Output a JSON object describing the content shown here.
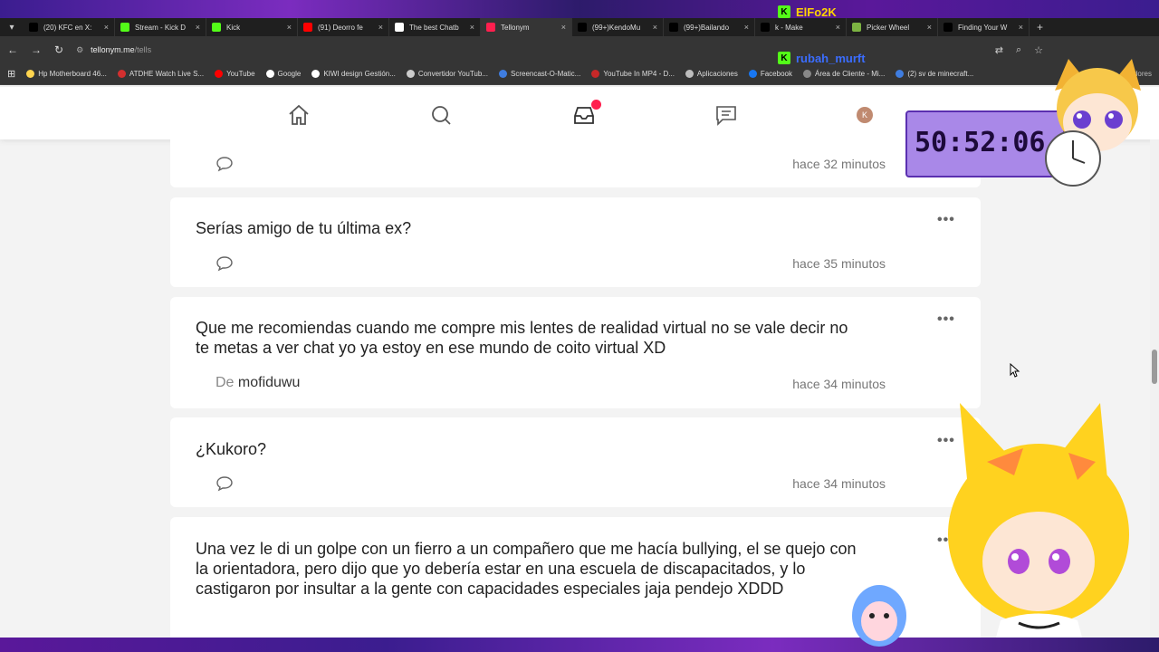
{
  "browser": {
    "tabs": [
      {
        "label": "(20) KFC en X:",
        "icon": "x-icon",
        "color": "#000000"
      },
      {
        "label": "Stream - Kick D",
        "icon": "kick-icon",
        "color": "#53fc18"
      },
      {
        "label": "Kick",
        "icon": "kick-icon",
        "color": "#53fc18"
      },
      {
        "label": "(91) Deorro fe",
        "icon": "youtube-icon",
        "color": "#ff0000"
      },
      {
        "label": "The best Chatb",
        "icon": "diamond-icon",
        "color": "#ffffff"
      },
      {
        "label": "Tellonym",
        "icon": "tellonym-icon",
        "color": "#ff1f4e"
      },
      {
        "label": "(99+)KendoMu",
        "icon": "tiktok-icon",
        "color": "#000000"
      },
      {
        "label": "(99+)Bailando",
        "icon": "tiktok-icon",
        "color": "#000000"
      },
      {
        "label": "k - Make",
        "icon": "tiktok-icon",
        "color": "#000000"
      },
      {
        "label": "Picker Wheel",
        "icon": "wheel-icon",
        "color": "#7cb342"
      },
      {
        "label": "Finding Your W",
        "icon": "tiktok-icon",
        "color": "#000000"
      }
    ],
    "new_tab": "+",
    "url_host": "tellonym.me",
    "url_path": "/tells",
    "bookmarks": [
      {
        "label": "Hp Motherboard 46...",
        "color": "#ffd54f"
      },
      {
        "label": "ATDHE Watch Live S...",
        "color": "#d32f2f"
      },
      {
        "label": "YouTube",
        "color": "#ff0000"
      },
      {
        "label": "Google",
        "color": "#ffffff"
      },
      {
        "label": "KIWI design Gestión...",
        "color": "#ffffff"
      },
      {
        "label": "Convertidor YouTub...",
        "color": "#cccccc"
      },
      {
        "label": "Screencast-O-Matic...",
        "color": "#3f7de0"
      },
      {
        "label": "YouTube In MP4 - D...",
        "color": "#c62828"
      },
      {
        "label": "Aplicaciones",
        "color": "#bdbdbd"
      },
      {
        "label": "Facebook",
        "color": "#1877f2"
      },
      {
        "label": "Área de Cliente - Mi...",
        "color": "#888888"
      },
      {
        "label": "(2) sv de minecraft...",
        "color": "#3f7de0"
      }
    ],
    "bookmarks_tail": "cadores"
  },
  "site_nav": {
    "items": [
      "home-icon",
      "search-icon",
      "inbox-icon",
      "chat-icon",
      "profile-avatar"
    ],
    "avatar_letter": "K",
    "accent": "#ff1f4e"
  },
  "tells": [
    {
      "text": "",
      "time": "hace 32 minutos",
      "from_label": "",
      "from_user": ""
    },
    {
      "text": "Serías amigo de tu última ex?",
      "time": "hace 35 minutos",
      "from_label": "",
      "from_user": ""
    },
    {
      "text": "Que me recomiendas cuando me compre mis lentes de realidad virtual no se vale decir no te metas a ver chat yo ya estoy en ese mundo de coito virtual XD",
      "time": "hace 34 minutos",
      "from_label": "De",
      "from_user": "mofiduwu"
    },
    {
      "text": "¿Kukoro?",
      "time": "hace 34 minutos",
      "from_label": "",
      "from_user": ""
    },
    {
      "text": "Una vez le di un golpe con un fierro a un compañero que me hacía bullying, el se quejo con la orientadora, pero dijo que yo debería estar en una escuela de discapacitados, y lo castigaron por insultar a la gente con capacidades especiales jaja pendejo XDDD",
      "time": "",
      "from_label": "",
      "from_user": ""
    }
  ],
  "more_glyph": "•••",
  "overlay": {
    "timer": "50:52:06",
    "streamer1": "ElFo2K",
    "streamer2": "rubah_murft",
    "streamer1_color": "#ffd400",
    "streamer2_color": "#3b6dff"
  }
}
